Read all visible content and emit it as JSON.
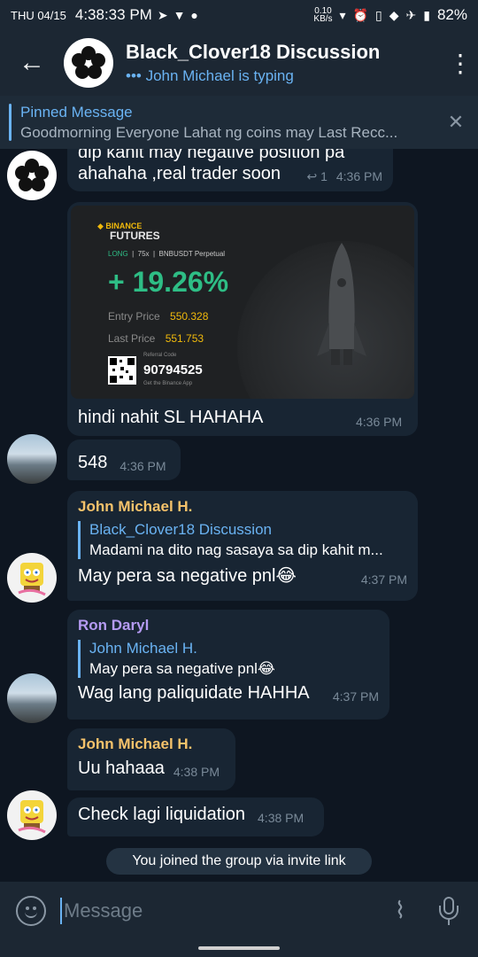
{
  "status": {
    "date": "THU 04/15",
    "time": "4:38:33 PM",
    "net_speed": "0.10",
    "net_unit": "KB/s",
    "battery": "82%",
    "icons": [
      "telegram-icon",
      "brave-icon",
      "notification-icon",
      "alarm-icon",
      "vibrate-icon",
      "wifi-icon",
      "airplane-icon",
      "battery-icon"
    ]
  },
  "header": {
    "title": "Black_Clover18 Discussion",
    "subtitle": "John Michael is typing",
    "typing_dots": "•••"
  },
  "pinned": {
    "label": "Pinned Message",
    "text": "Goodmorning Everyone  Lahat ng coins may Last Recc..."
  },
  "messages": [
    {
      "id": "m1",
      "text": "dip kahit may negative position pa ahahaha ,real trader soon",
      "replies": "1",
      "time": "4:36 PM"
    },
    {
      "id": "m2",
      "image": {
        "exchange": "BINANCE",
        "product": "FUTURES",
        "side": "LONG",
        "leverage": "75x",
        "pair": "BNBUSDT Perpetual",
        "pnl": "+ 19.26%",
        "entry_label": "Entry Price",
        "entry_value": "550.328",
        "last_label": "Last Price",
        "last_value": "551.753",
        "ref_label": "Referral Code",
        "ref_code": "90794525",
        "app_label": "Get the Binance App"
      },
      "text": "hindi nahit SL HAHAHA",
      "time": "4:36 PM"
    },
    {
      "id": "m3",
      "text": "548",
      "time": "4:36 PM"
    },
    {
      "id": "m4",
      "sender": "John Michael H.",
      "reply_to": {
        "name": "Black_Clover18 Discussion",
        "text": "Madami na dito nag sasaya sa dip kahit m..."
      },
      "text": "May pera sa negative pnl😂",
      "time": "4:37 PM"
    },
    {
      "id": "m5",
      "sender": "Ron Daryl",
      "reply_to": {
        "name": "John Michael H.",
        "text": "May pera sa negative pnl😂"
      },
      "text": "Wag lang paliquidate HAHHA",
      "time": "4:37 PM"
    },
    {
      "id": "m6",
      "sender": "John Michael H.",
      "text": "Uu hahaaa",
      "time": "4:38 PM"
    },
    {
      "id": "m7",
      "text": "Check lagi liquidation",
      "time": "4:38 PM"
    }
  ],
  "service_message": "You joined the group via invite link",
  "composer": {
    "placeholder": "Message"
  },
  "colors": {
    "accent": "#6ab3f3",
    "sender_orange": "#f5c26b",
    "sender_purple": "#b59bf3",
    "bubble": "#182533",
    "background": "#0e1621",
    "pnl_green": "#2ebd85"
  }
}
